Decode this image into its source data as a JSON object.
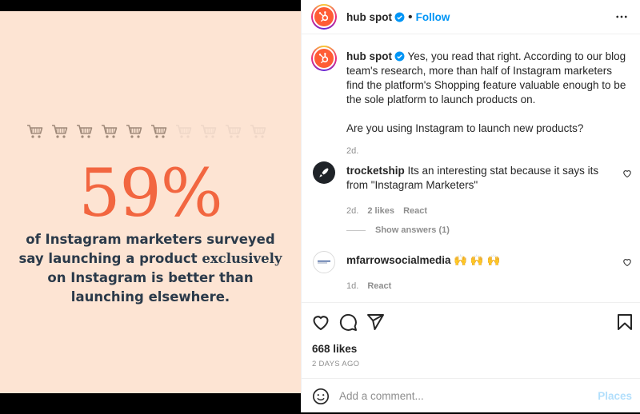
{
  "post_image": {
    "stat": "59%",
    "lines": [
      "of Instagram marketers surveyed",
      "say launching a product",
      "exclusively",
      "on Instagram is better than",
      "launching elsewhere."
    ],
    "carts_filled": 6,
    "carts_total": 10
  },
  "header": {
    "username": "hub spot",
    "separator": "•",
    "follow_label": "Follow"
  },
  "caption": {
    "username": "hub spot",
    "text": "Yes, you read that right. According to our blog team's research, more than half of Instagram marketers find the platform's Shopping feature valuable enough to be the sole platform to launch products on.",
    "question": "Are you using Instagram to launch new products?",
    "age": "2d."
  },
  "comments": [
    {
      "username": "trocketship",
      "text": "Its an interesting stat because it says its from \"Instagram Marketers\"",
      "age": "2d.",
      "likes": "2 likes",
      "reply": "React"
    },
    {
      "username": "mfarrowsocialmedia",
      "text": "🙌 🙌 🙌",
      "age": "1d.",
      "reply": "React"
    }
  ],
  "show_answers": "Show answers (1)",
  "likes": "668 likes",
  "date": "2 DAYS AGO",
  "add_comment": {
    "placeholder": "Add a comment...",
    "post_label": "Places"
  },
  "colors": {
    "accent_blue": "#0095f6",
    "hubspot_orange": "#ff5c35",
    "stat_color": "#f26640",
    "image_bg": "#fde4d3"
  }
}
